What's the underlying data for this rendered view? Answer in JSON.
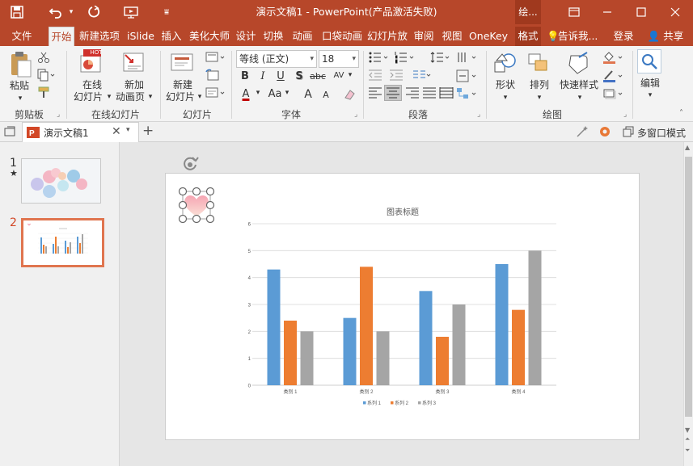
{
  "titlebar": {
    "title": "演示文稿1 - PowerPoint(产品激活失败)",
    "context_tab": "绘...",
    "save_icon": "save-icon",
    "undo_icon": "undo-icon",
    "redo_icon": "redo-icon",
    "slideshow_icon": "slideshow-icon",
    "customize_icon": "customize-qat-icon",
    "bg_color": "#b7472a"
  },
  "tabs": [
    {
      "label": "文件"
    },
    {
      "label": "开始"
    },
    {
      "label": "新建选项"
    },
    {
      "label": "iSlide"
    },
    {
      "label": "插入"
    },
    {
      "label": "美化大师"
    },
    {
      "label": "设计"
    },
    {
      "label": "切换"
    },
    {
      "label": "动画"
    },
    {
      "label": "口袋动画"
    },
    {
      "label": "幻灯片放"
    },
    {
      "label": "审阅"
    },
    {
      "label": "视图"
    },
    {
      "label": "OneKey"
    },
    {
      "label": "格式"
    }
  ],
  "tellme": "告诉我...",
  "signin": "登录",
  "share": "共享",
  "ribbon": {
    "clipboard": {
      "paste": "粘贴",
      "label": "剪贴板"
    },
    "online": {
      "online_slide": "在线",
      "online_slide2": "幻灯片",
      "online_anim": "新加",
      "online_anim2": "动画页",
      "hot": "HOT",
      "label": "在线幻灯片"
    },
    "slides": {
      "new_slide": "新建",
      "new_slide2": "幻灯片",
      "label": "幻灯片"
    },
    "font": {
      "font_name": "等线 (正文)",
      "font_size": "18",
      "bold": "B",
      "italic": "I",
      "underline": "U",
      "shadow": "S",
      "strike": "abc",
      "spacing": "AV",
      "font_color_letter": "A",
      "aa": "Aa",
      "grow": "A",
      "shrink": "A",
      "label": "字体"
    },
    "paragraph": {
      "label": "段落"
    },
    "drawing": {
      "shape": "形状",
      "arrange": "排列",
      "quick_style": "快速样式",
      "label": "绘图"
    },
    "editing": {
      "edit": "编辑"
    }
  },
  "doctab": {
    "name": "演示文稿1",
    "multiwindow": "多窗口模式"
  },
  "slides": [
    {
      "number": "1",
      "star": "★"
    },
    {
      "number": "2"
    }
  ],
  "chart_data": {
    "type": "bar",
    "title": "图表标题",
    "categories": [
      "类别 1",
      "类别 2",
      "类别 3",
      "类别 4"
    ],
    "series": [
      {
        "name": "系列 1",
        "values": [
          4.3,
          2.5,
          3.5,
          4.5
        ],
        "color": "#5b9bd5"
      },
      {
        "name": "系列 2",
        "values": [
          2.4,
          4.4,
          1.8,
          2.8
        ],
        "color": "#ed7d31"
      },
      {
        "name": "系列 3",
        "values": [
          2,
          2,
          3,
          5
        ],
        "color": "#a5a5a5"
      }
    ],
    "ylim": [
      0,
      6
    ],
    "yticks": [
      "0",
      "1",
      "2",
      "3",
      "4",
      "5",
      "6"
    ],
    "grid": true,
    "legend": "bottom"
  }
}
